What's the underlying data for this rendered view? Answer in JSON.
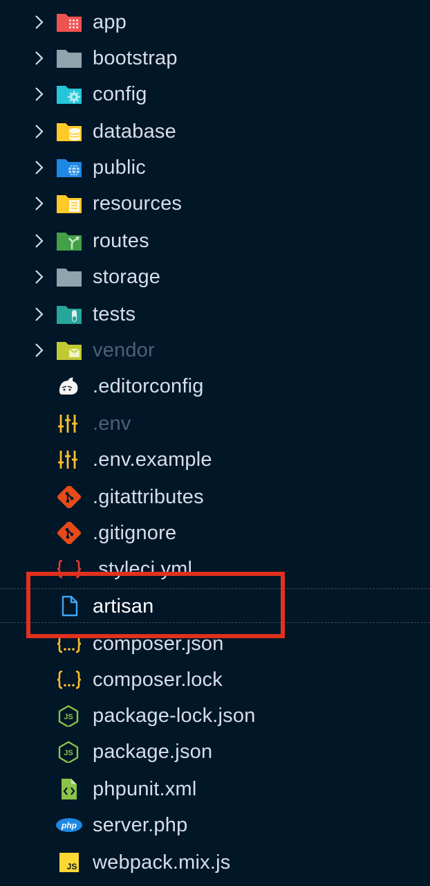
{
  "explorer": {
    "folders": [
      {
        "label": "app",
        "icon": "app-folder-icon",
        "color": "#ef5350"
      },
      {
        "label": "bootstrap",
        "icon": "folder-icon",
        "color": "#90a4ae"
      },
      {
        "label": "config",
        "icon": "config-folder-icon",
        "color": "#26c6da"
      },
      {
        "label": "database",
        "icon": "database-folder-icon",
        "color": "#ffca28"
      },
      {
        "label": "public",
        "icon": "public-folder-icon",
        "color": "#1e88e5"
      },
      {
        "label": "resources",
        "icon": "resources-folder-icon",
        "color": "#ffca28"
      },
      {
        "label": "routes",
        "icon": "routes-folder-icon",
        "color": "#43a047"
      },
      {
        "label": "storage",
        "icon": "folder-icon",
        "color": "#90a4ae"
      },
      {
        "label": "tests",
        "icon": "tests-folder-icon",
        "color": "#26a69a"
      },
      {
        "label": "vendor",
        "icon": "vendor-folder-icon",
        "color": "#c0ca33"
      }
    ],
    "files": [
      {
        "label": ".editorconfig",
        "icon": "editorconfig-icon"
      },
      {
        "label": ".env",
        "icon": "env-tune-icon"
      },
      {
        "label": ".env.example",
        "icon": "env-tune-icon"
      },
      {
        "label": ".gitattributes",
        "icon": "git-icon"
      },
      {
        "label": ".gitignore",
        "icon": "git-icon"
      },
      {
        "label": ".styleci.yml",
        "icon": "yaml-braces-icon"
      },
      {
        "label": "artisan",
        "icon": "file-icon"
      },
      {
        "label": "composer.json",
        "icon": "json-braces-icon"
      },
      {
        "label": "composer.lock",
        "icon": "json-braces-icon"
      },
      {
        "label": "package-lock.json",
        "icon": "nodejs-icon"
      },
      {
        "label": "package.json",
        "icon": "nodejs-icon"
      },
      {
        "label": "phpunit.xml",
        "icon": "xml-icon"
      },
      {
        "label": "server.php",
        "icon": "php-icon"
      },
      {
        "label": "webpack.mix.js",
        "icon": "javascript-icon"
      }
    ],
    "highlight_color": "#e0311e"
  }
}
